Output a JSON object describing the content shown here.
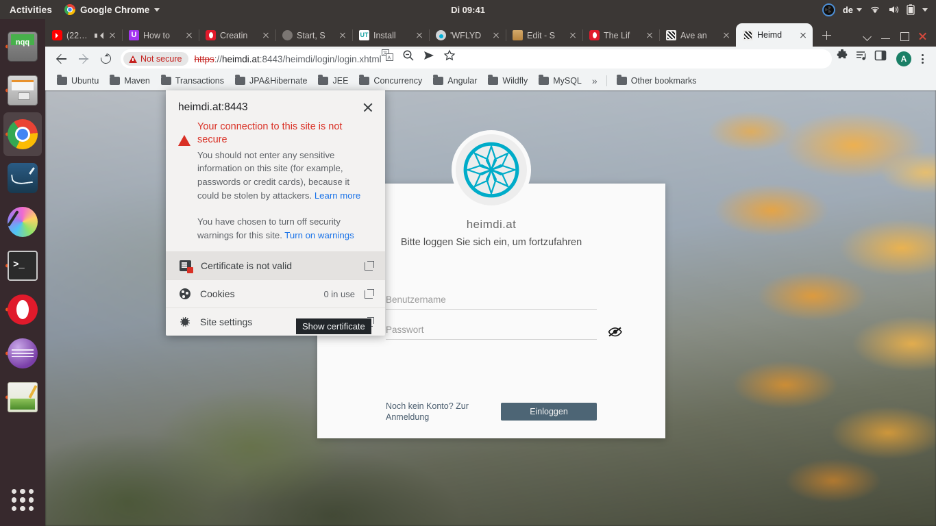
{
  "desktop": {
    "activities": "Activities",
    "app_menu": "Google Chrome",
    "clock": "Di 09:41",
    "keyboard_layout": "de",
    "dock_items": [
      {
        "name": "notepadqq",
        "label": "Notepadqq"
      },
      {
        "name": "files",
        "label": "Files"
      },
      {
        "name": "chrome",
        "label": "Google Chrome"
      },
      {
        "name": "mysql-workbench",
        "label": "MySQL Workbench"
      },
      {
        "name": "krita",
        "label": "Krita"
      },
      {
        "name": "terminal",
        "label": "Terminal"
      },
      {
        "name": "opera",
        "label": "Opera"
      },
      {
        "name": "eclipse",
        "label": "Eclipse"
      },
      {
        "name": "gedit",
        "label": "Text Editor"
      }
    ]
  },
  "browser": {
    "tabs": [
      {
        "title": "(22…",
        "favicon": "youtube-icon",
        "audio": true,
        "active": false
      },
      {
        "title": "How to",
        "favicon": "udemy-icon",
        "active": false
      },
      {
        "title": "Creatin",
        "favicon": "opera-icon",
        "active": false
      },
      {
        "title": "Start, S",
        "favicon": "gray-globe-icon",
        "active": false
      },
      {
        "title": "Install",
        "favicon": "ut-icon",
        "active": false
      },
      {
        "title": "'WFLYD",
        "favicon": "cloud-icon",
        "active": false
      },
      {
        "title": "Edit - S",
        "favicon": "stackoverflow-icon",
        "active": false
      },
      {
        "title": "The Lif",
        "favicon": "opera-icon",
        "active": false
      },
      {
        "title": "Ave an",
        "favicon": "wildfly-icon",
        "active": false
      },
      {
        "title": "Heimd",
        "favicon": "wildfly-icon",
        "active": true
      }
    ],
    "new_tab_label": "New tab",
    "window_controls": [
      "minimize",
      "maximize",
      "close"
    ],
    "nav": {
      "back": "Back",
      "forward": "Forward",
      "reload": "Reload"
    },
    "omnibox": {
      "security_label": "Not secure",
      "url_scheme": "https",
      "url_scheme_sep": "://",
      "url_host": "heimdi.at",
      "url_rest": ":8443/heimdi/login/login.xhtml"
    },
    "toolbar_icons": [
      "translate-icon",
      "zoom-out-icon",
      "send-icon",
      "bookmark-star-icon",
      "extensions-icon",
      "media-playlist-icon",
      "side-panel-icon"
    ],
    "profile_initial": "A",
    "menu_label": "Customize and control Google Chrome",
    "bookmarks": [
      "Ubuntu",
      "Maven",
      "Transactions",
      "JPA&Hibernate",
      "JEE",
      "Concurrency",
      "Angular",
      "Wildfly",
      "MySQL"
    ],
    "bookmarks_overflow": "»",
    "other_bookmarks": "Other bookmarks"
  },
  "popup": {
    "site": "heimdi.at:8443",
    "close_label": "Close",
    "headline": "Your connection to this site is not secure",
    "body": "You should not enter any sensitive information on this site (for example, passwords or credit cards), because it could be stolen by attackers.",
    "learn_more": "Learn more",
    "note_prefix": "You have chosen to turn off security warnings for this site. ",
    "note_link": "Turn on warnings",
    "rows": [
      {
        "icon": "certificate-invalid-icon",
        "label": "Certificate is not valid",
        "right": "",
        "external": true
      },
      {
        "icon": "cookie-icon",
        "label": "Cookies",
        "right": "0 in use",
        "external": true
      },
      {
        "icon": "gear-icon",
        "label": "Site settings",
        "right": "",
        "external": true
      }
    ],
    "tooltip": "Show certificate"
  },
  "login": {
    "logo": "eight-point-star-logo",
    "logo_color": "#00acc9",
    "title": "heimdi.at",
    "subtitle": "Bitte loggen Sie sich ein, um fortzufahren",
    "username_placeholder": "Benutzername",
    "username_value": "",
    "password_placeholder": "Passwort",
    "password_value": "",
    "toggle_password_label": "eye-off-icon",
    "signup_text": "Noch kein Konto? Zur Anmeldung",
    "submit_label": "Einloggen",
    "submit_color": "#4d6575"
  }
}
